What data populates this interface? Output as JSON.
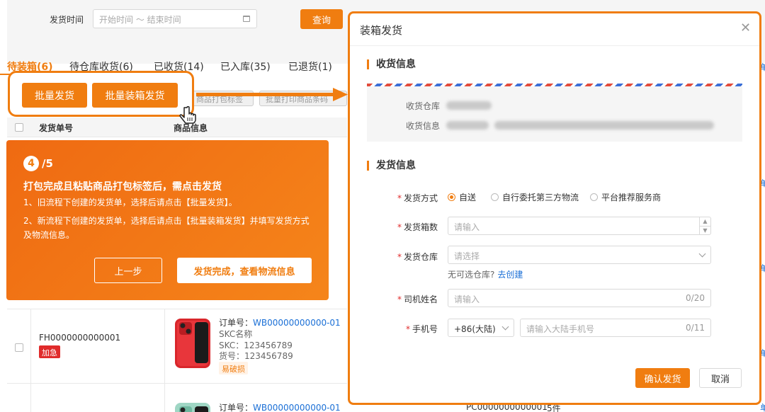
{
  "filter": {
    "label": "发货时间",
    "date_placeholder": "开始时间 ～ 结束时间",
    "query_label": "查询"
  },
  "tabs": [
    {
      "label": "待装箱(6)"
    },
    {
      "label": "待仓库收货(6)"
    },
    {
      "label": "已收货(14)"
    },
    {
      "label": "已入库(35)"
    },
    {
      "label": "已退货(1)"
    }
  ],
  "actions": {
    "batch_ship": "批量发货",
    "batch_box_ship": "批量装箱发货",
    "print_pack": "商品打包标签",
    "print_goods": "批量打印商品条码"
  },
  "table": {
    "col_order": "发货单号",
    "col_product": "商品信息"
  },
  "rows": [
    {
      "order_no": "FH0000000000001",
      "tag": "加急",
      "sub_no_label": "订单号：",
      "sub_no": "WB00000000000-01",
      "skc_name": "SKC名称",
      "skc": "SKC：123456789",
      "sku": "货号：123456789",
      "badge": "易破损"
    },
    {
      "sub_no_label": "订单号：",
      "sub_no": "WB00000000000-01",
      "pc_no": "PC0000000000001",
      "qty": "5件"
    }
  ],
  "right_links": [
    "单",
    "单",
    "单",
    "单",
    "单"
  ],
  "guide": {
    "step": "4",
    "total": "/5",
    "title": "打包完成且粘贴商品打包标签后，需点击发货",
    "line1": "1、旧流程下创建的发货单，选择后请点击【批量发货】。",
    "line2": "2、新流程下创建的发货单，选择后请点击【批量装箱发货】并填写发货方式及物流信息。",
    "prev": "上一步",
    "next": "发货完成，查看物流信息"
  },
  "dialog": {
    "title": "装箱发货",
    "close_icon": "close-icon",
    "recv_section": "收货信息",
    "recv_warehouse_label": "收货仓库",
    "recv_info_label": "收货信息",
    "ship_section": "发货信息",
    "method_label": "发货方式",
    "methods": [
      "自送",
      "自行委托第三方物流",
      "平台推荐服务商"
    ],
    "selected_method": "自送",
    "boxes_label": "发货箱数",
    "boxes_placeholder": "请输入",
    "warehouse_label": "发货仓库",
    "warehouse_placeholder": "请选择",
    "no_warehouse": "无可选仓库?",
    "create_link": "去创建",
    "driver_label": "司机姓名",
    "driver_placeholder": "请输入",
    "driver_count": "0/20",
    "phone_label": "手机号",
    "phone_prefix": "+86(大陆)",
    "phone_placeholder": "请输入大陆手机号",
    "phone_count": "0/11",
    "confirm": "确认发货",
    "cancel": "取消"
  },
  "colors": {
    "accent": "#f07d10",
    "link": "#1a6fd6",
    "urgent": "#e02b2b"
  }
}
